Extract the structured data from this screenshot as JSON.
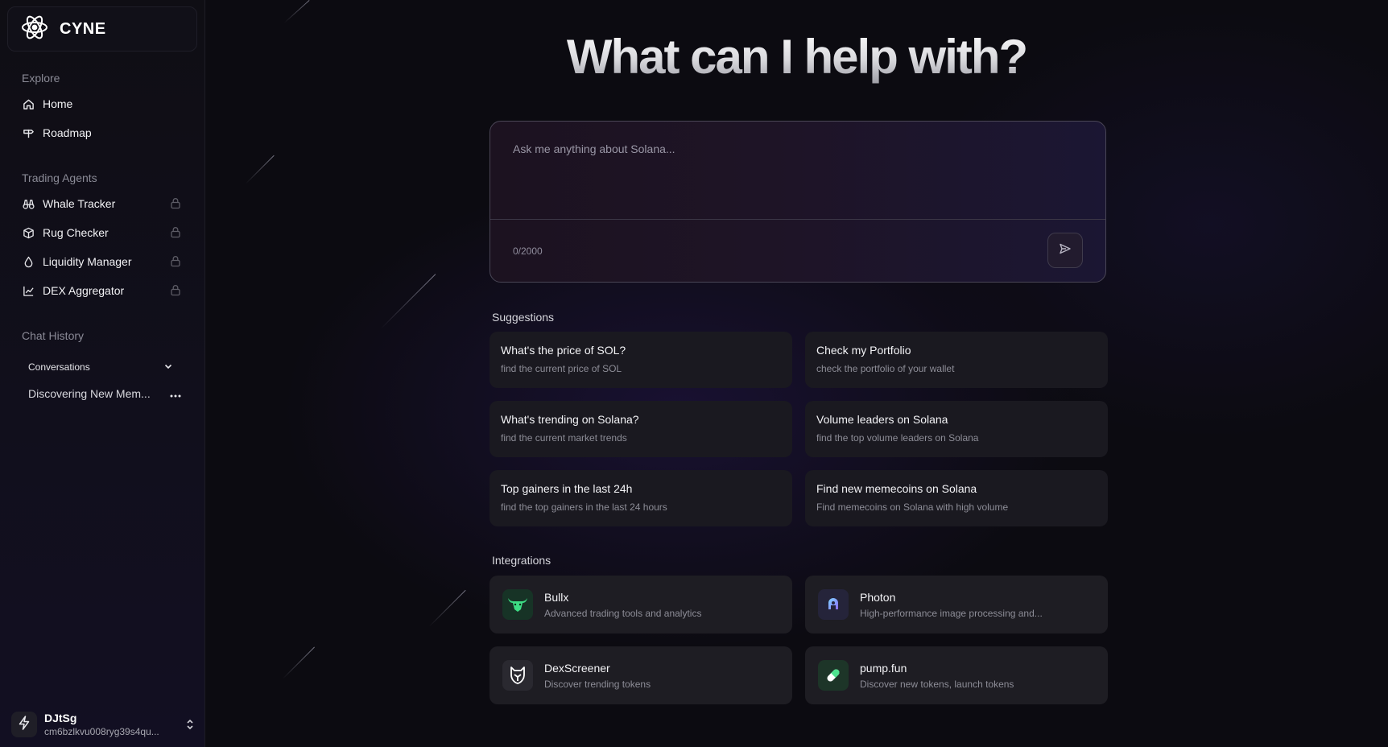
{
  "brand": {
    "name": "CYNE",
    "logo_icon": "atom-icon"
  },
  "sidebar": {
    "explore_label": "Explore",
    "explore_items": [
      {
        "label": "Home",
        "icon": "home-icon"
      },
      {
        "label": "Roadmap",
        "icon": "signpost-icon"
      }
    ],
    "agents_label": "Trading Agents",
    "agents": [
      {
        "label": "Whale Tracker",
        "icon": "binoculars-icon",
        "locked": true
      },
      {
        "label": "Rug Checker",
        "icon": "cube-icon",
        "locked": true
      },
      {
        "label": "Liquidity Manager",
        "icon": "droplet-icon",
        "locked": true
      },
      {
        "label": "DEX Aggregator",
        "icon": "line-chart-icon",
        "locked": true
      }
    ],
    "history_label": "Chat History",
    "conversations_label": "Conversations",
    "conversations": [
      {
        "title": "Discovering New Mem..."
      }
    ]
  },
  "user": {
    "name": "DJtSg",
    "id": "cm6bzlkvu008ryg39s4qu..."
  },
  "main": {
    "headline": "What can I help with?",
    "chat": {
      "placeholder": "Ask me anything about Solana...",
      "value": "",
      "char_count": "0/2000"
    },
    "suggestions_label": "Suggestions",
    "suggestions": [
      {
        "title": "What's the price of SOL?",
        "subtitle": "find the current price of SOL"
      },
      {
        "title": "Check my Portfolio",
        "subtitle": "check the portfolio of your wallet"
      },
      {
        "title": "What's trending on Solana?",
        "subtitle": "find the current market trends"
      },
      {
        "title": "Volume leaders on Solana",
        "subtitle": "find the top volume leaders on Solana"
      },
      {
        "title": "Top gainers in the last 24h",
        "subtitle": "find the top gainers in the last 24 hours"
      },
      {
        "title": "Find new memecoins on Solana",
        "subtitle": "Find memecoins on Solana with high volume"
      }
    ],
    "integrations_label": "Integrations",
    "integrations": [
      {
        "title": "Bullx",
        "subtitle": "Advanced trading tools and analytics",
        "icon": "bull-icon"
      },
      {
        "title": "Photon",
        "subtitle": "High-performance image processing and...",
        "icon": "photon-icon"
      },
      {
        "title": "DexScreener",
        "subtitle": "Discover trending tokens",
        "icon": "dexscreener-icon"
      },
      {
        "title": "pump.fun",
        "subtitle": "Discover new tokens, launch tokens",
        "icon": "pill-icon"
      }
    ]
  },
  "colors": {
    "background": "#0c0b11",
    "sidebar": "#0f0e14",
    "card": "#1a1920",
    "accent_green": "#3ddc84"
  }
}
